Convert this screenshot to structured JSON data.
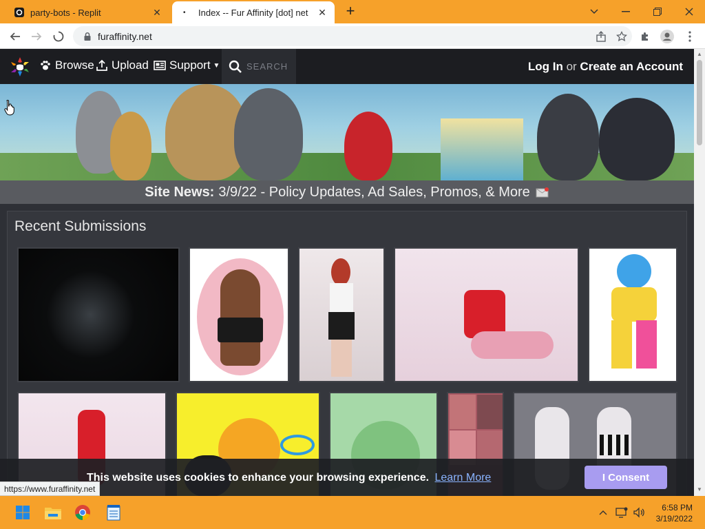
{
  "browser": {
    "tabs": [
      {
        "title": "party-bots - Replit",
        "active": false
      },
      {
        "title": "Index -- Fur Affinity [dot] net",
        "active": true
      }
    ],
    "url": "furaffinity.net",
    "status_link": "https://www.furaffinity.net"
  },
  "site": {
    "nav": {
      "browse": "Browse",
      "upload": "Upload",
      "support": "Support",
      "search_placeholder": "SEARCH",
      "login": "Log In",
      "or": "or",
      "create": "Create an Account"
    },
    "news": {
      "label": "Site News:",
      "text": "3/9/22 - Policy Updates, Ad Sales, Promos, & More"
    },
    "recent_title": "Recent Submissions"
  },
  "cookie": {
    "message": "This website uses cookies to enhance your browsing experience.",
    "learn_more": "Learn More",
    "consent": "I Consent"
  },
  "taskbar": {
    "time": "6:58 PM",
    "date": "3/19/2022"
  },
  "colors": {
    "chrome_accent": "#f6a12a",
    "site_nav": "#1c1d21",
    "consent_button": "#a89cf0"
  }
}
